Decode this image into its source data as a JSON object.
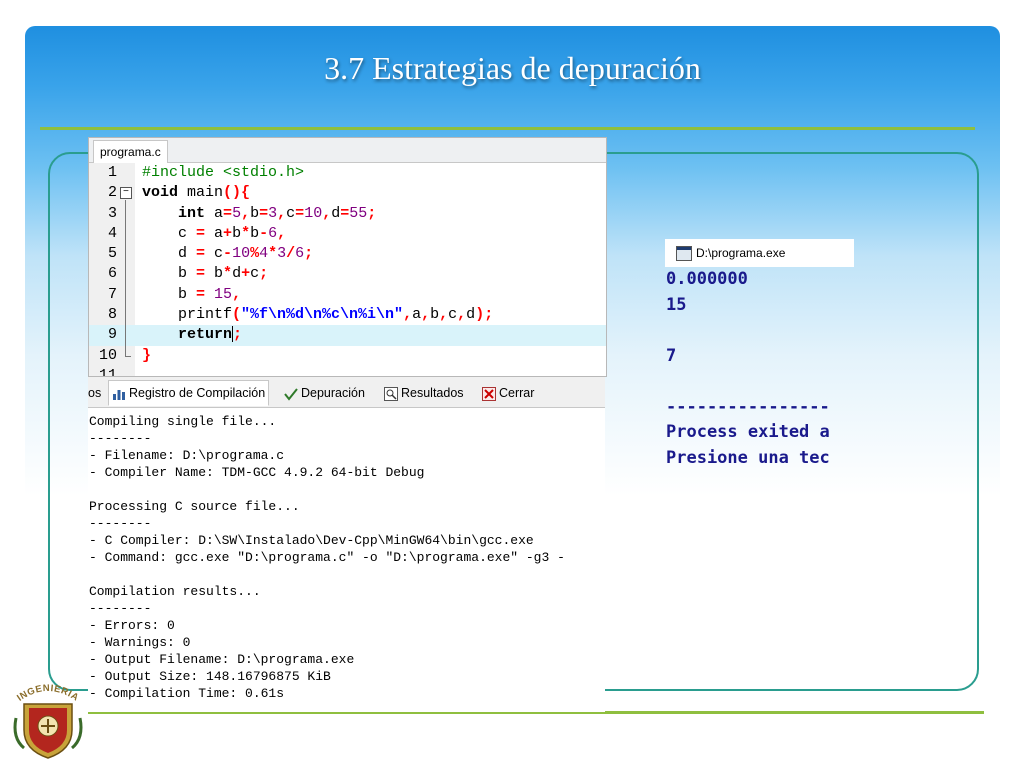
{
  "slide": {
    "title": "3.7  Estrategias de depuración"
  },
  "editor": {
    "tab_label": "programa.c",
    "lines": [
      {
        "num": "1",
        "segments": [
          {
            "t": "#include <stdio.h>",
            "c": "pp"
          }
        ]
      },
      {
        "num": "2",
        "segments": [
          {
            "t": "void",
            "c": "kw"
          },
          {
            "t": " main",
            "c": ""
          },
          {
            "t": "(){",
            "c": "op"
          }
        ]
      },
      {
        "num": "3",
        "segments": [
          {
            "t": "    ",
            "c": ""
          },
          {
            "t": "int",
            "c": "kw"
          },
          {
            "t": " a",
            "c": ""
          },
          {
            "t": "=",
            "c": "op"
          },
          {
            "t": "5",
            "c": "num"
          },
          {
            "t": ",",
            "c": "op"
          },
          {
            "t": "b",
            "c": ""
          },
          {
            "t": "=",
            "c": "op"
          },
          {
            "t": "3",
            "c": "num"
          },
          {
            "t": ",",
            "c": "op"
          },
          {
            "t": "c",
            "c": ""
          },
          {
            "t": "=",
            "c": "op"
          },
          {
            "t": "10",
            "c": "num"
          },
          {
            "t": ",",
            "c": "op"
          },
          {
            "t": "d",
            "c": ""
          },
          {
            "t": "=",
            "c": "op"
          },
          {
            "t": "55",
            "c": "num"
          },
          {
            "t": ";",
            "c": "op"
          }
        ]
      },
      {
        "num": "4",
        "segments": [
          {
            "t": "    c ",
            "c": ""
          },
          {
            "t": "=",
            "c": "op"
          },
          {
            "t": " a",
            "c": ""
          },
          {
            "t": "+",
            "c": "op"
          },
          {
            "t": "b",
            "c": ""
          },
          {
            "t": "*",
            "c": "op"
          },
          {
            "t": "b",
            "c": ""
          },
          {
            "t": "-",
            "c": "op"
          },
          {
            "t": "6",
            "c": "num"
          },
          {
            "t": ",",
            "c": "op"
          }
        ]
      },
      {
        "num": "5",
        "segments": [
          {
            "t": "    d ",
            "c": ""
          },
          {
            "t": "=",
            "c": "op"
          },
          {
            "t": " c",
            "c": ""
          },
          {
            "t": "-",
            "c": "op"
          },
          {
            "t": "10",
            "c": "num"
          },
          {
            "t": "%",
            "c": "op"
          },
          {
            "t": "4",
            "c": "num"
          },
          {
            "t": "*",
            "c": "op"
          },
          {
            "t": "3",
            "c": "num"
          },
          {
            "t": "/",
            "c": "op"
          },
          {
            "t": "6",
            "c": "num"
          },
          {
            "t": ";",
            "c": "op"
          }
        ]
      },
      {
        "num": "6",
        "segments": [
          {
            "t": "    b ",
            "c": ""
          },
          {
            "t": "=",
            "c": "op"
          },
          {
            "t": " b",
            "c": ""
          },
          {
            "t": "*",
            "c": "op"
          },
          {
            "t": "d",
            "c": ""
          },
          {
            "t": "+",
            "c": "op"
          },
          {
            "t": "c",
            "c": ""
          },
          {
            "t": ";",
            "c": "op"
          }
        ]
      },
      {
        "num": "7",
        "segments": [
          {
            "t": "    b ",
            "c": ""
          },
          {
            "t": "=",
            "c": "op"
          },
          {
            "t": " ",
            "c": ""
          },
          {
            "t": "15",
            "c": "num"
          },
          {
            "t": ",",
            "c": "op"
          }
        ]
      },
      {
        "num": "8",
        "segments": [
          {
            "t": "    printf",
            "c": ""
          },
          {
            "t": "(",
            "c": "op"
          },
          {
            "t": "\"%f\\n%d\\n%c\\n%i\\n\"",
            "c": "str"
          },
          {
            "t": ",",
            "c": "op"
          },
          {
            "t": "a",
            "c": ""
          },
          {
            "t": ",",
            "c": "op"
          },
          {
            "t": "b",
            "c": ""
          },
          {
            "t": ",",
            "c": "op"
          },
          {
            "t": "c",
            "c": ""
          },
          {
            "t": ",",
            "c": "op"
          },
          {
            "t": "d",
            "c": ""
          },
          {
            "t": ");",
            "c": "op"
          }
        ]
      },
      {
        "num": "9",
        "segments": [
          {
            "t": "    ",
            "c": ""
          },
          {
            "t": "return",
            "c": "kw"
          },
          {
            "t": "|",
            "c": "caret"
          },
          {
            "t": ";",
            "c": "op"
          }
        ],
        "current": true
      },
      {
        "num": "10",
        "segments": [
          {
            "t": "}",
            "c": "op"
          }
        ]
      },
      {
        "num": "11",
        "segments": []
      }
    ]
  },
  "log_tabs": [
    {
      "label": "os",
      "icon": "",
      "active": false
    },
    {
      "label": "Registro de Compilación",
      "icon": "bar-chart-icon",
      "active": true
    },
    {
      "label": "Depuración",
      "icon": "checkmark-icon",
      "active": false
    },
    {
      "label": "Resultados",
      "icon": "search-results-icon",
      "active": false
    },
    {
      "label": "Cerrar",
      "icon": "close-tab-icon",
      "active": false
    }
  ],
  "log_lines": [
    "Compiling single file...",
    "--------",
    "- Filename: D:\\programa.c",
    "- Compiler Name: TDM-GCC 4.9.2 64-bit Debug",
    "",
    "Processing C source file...",
    "--------",
    "- C Compiler: D:\\SW\\Instalado\\Dev-Cpp\\MinGW64\\bin\\gcc.exe",
    "- Command: gcc.exe \"D:\\programa.c\" -o \"D:\\programa.exe\" -g3 -",
    "",
    "Compilation results...",
    "--------",
    "- Errors: 0",
    "- Warnings: 0",
    "- Output Filename: D:\\programa.exe",
    "- Output Size: 148.16796875 KiB",
    "- Compilation Time: 0.61s"
  ],
  "console": {
    "title": "D:\\programa.exe",
    "lines": [
      "0.000000",
      "15",
      "",
      "7",
      "",
      "----------------",
      "Process exited a",
      "Presione una tec"
    ]
  },
  "logo": {
    "text": "INGENIERIA"
  },
  "colors": {
    "accent_rule": "#8fbf3f",
    "frame": "#2a9d8f",
    "title_bg_top": "#1f8fe0",
    "console_text": "#1a1a8c"
  }
}
